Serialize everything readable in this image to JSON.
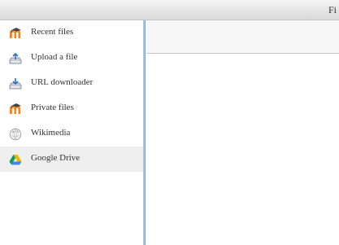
{
  "header": {
    "title": "Fi"
  },
  "sidebar": {
    "items": [
      {
        "label": "Recent files",
        "icon": "moodle-icon",
        "selected": false
      },
      {
        "label": "Upload a file",
        "icon": "upload-icon",
        "selected": false
      },
      {
        "label": "URL downloader",
        "icon": "url-downloader-icon",
        "selected": false
      },
      {
        "label": "Private files",
        "icon": "moodle-icon",
        "selected": false
      },
      {
        "label": "Wikimedia",
        "icon": "wikimedia-icon",
        "selected": false
      },
      {
        "label": "Google Drive",
        "icon": "google-drive-icon",
        "selected": true
      }
    ]
  },
  "colors": {
    "moodle_orange": "#f98012",
    "selected_bg": "#efefef",
    "divider_blue": "#a7c7e6"
  }
}
